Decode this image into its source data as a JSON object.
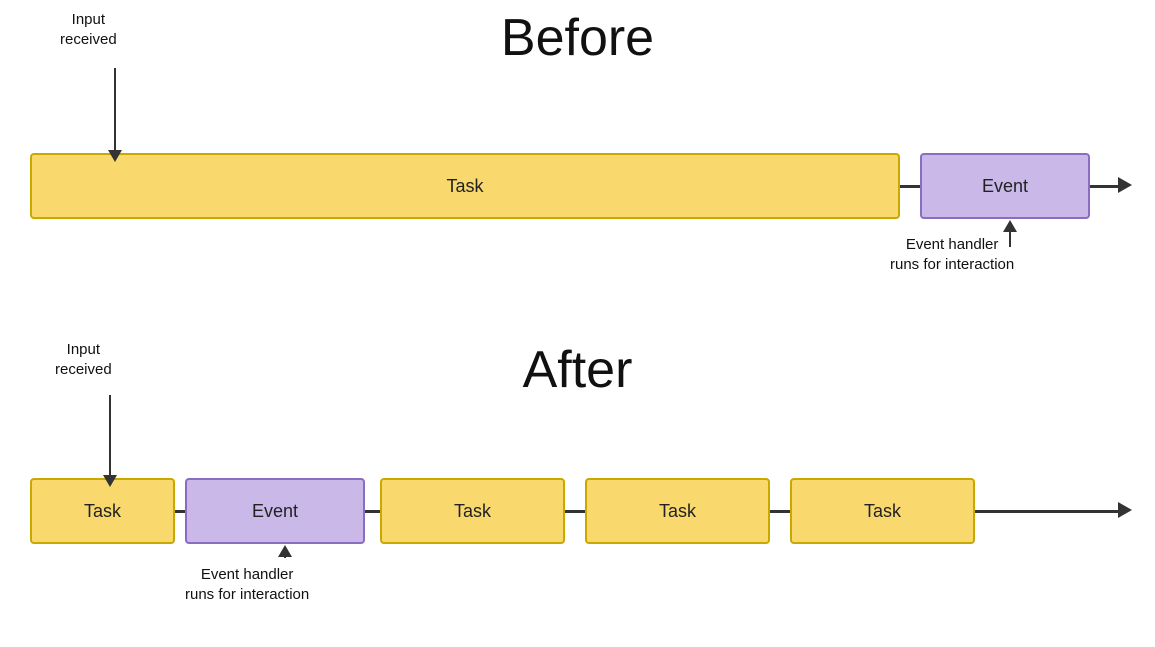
{
  "before": {
    "title": "Before",
    "input_label": "Input\nreceived",
    "event_handler_label": "Event handler\nruns for interaction",
    "task_label": "Task",
    "event_label": "Event"
  },
  "after": {
    "title": "After",
    "input_label": "Input\nreceived",
    "event_handler_label": "Event handler\nruns for interaction",
    "task_label": "Task",
    "event_label": "Event"
  },
  "colors": {
    "task_bg": "#f9d96e",
    "task_border": "#c9a800",
    "event_bg": "#c9b8e8",
    "event_border": "#8a6cc0"
  }
}
